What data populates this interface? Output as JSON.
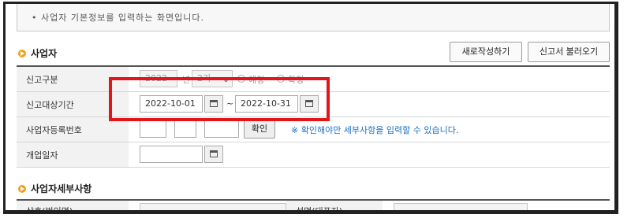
{
  "notice": "• 사업자 기본정보를 입력하는 화면입니다.",
  "section1_title": "사업자",
  "buttons": {
    "new": "새로작성하기",
    "load": "신고서 불러오기",
    "confirm": "확인"
  },
  "rows": {
    "report_type": {
      "label": "신고구분",
      "year": "2022",
      "year_unit": "년",
      "period": "2기",
      "opt_scheduled": "예정",
      "opt_final": "확정"
    },
    "period": {
      "label": "신고대상기간",
      "start": "2022-10-01",
      "tilde": "~",
      "end": "2022-10-31"
    },
    "bizno": {
      "label": "사업자등록번호",
      "hint": "※ 확인해야만 세부사항을 입력할 수 있습니다."
    },
    "open_date": {
      "label": "개업일자"
    }
  },
  "section2_title": "사업자세부사항",
  "detail": {
    "name_label": "상호(법인명)",
    "rep_label": "성명(대표자)"
  },
  "colors": {
    "highlight": "#e4141b",
    "hint": "#1a6fc4",
    "section_dot": "#f0a020"
  }
}
